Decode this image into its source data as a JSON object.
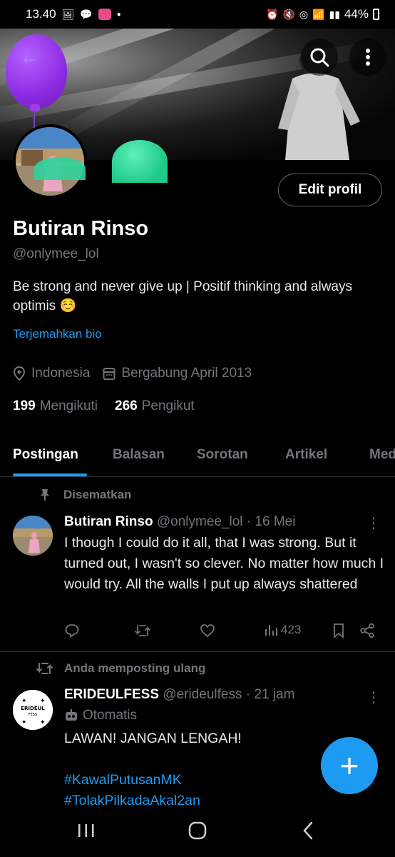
{
  "status_bar": {
    "time": "13.40",
    "battery": "44%",
    "app_icon_label": "LINE"
  },
  "profile": {
    "edit_label": "Edit profil",
    "name": "Butiran Rinso",
    "handle": "@onlymee_lol",
    "bio": "Be strong and never give up | Positif thinking and always optimis ☺️",
    "translate_label": "Terjemahkan bio",
    "location": "Indonesia",
    "joined": "Bergabung April 2013",
    "following_count": "199",
    "following_label": "Mengikuti",
    "followers_count": "266",
    "followers_label": "Pengikut"
  },
  "tabs": [
    "Postingan",
    "Balasan",
    "Sorotan",
    "Artikel",
    "Media"
  ],
  "pinned_post": {
    "pinned_label": "Disematkan",
    "author": "Butiran Rinso",
    "handle": "@onlymee_lol",
    "time": "· 16 Mei",
    "text": "I though I could do it all, that I was strong. But it turned out, I wasn't  so clever. No matter how much I would try. All the walls I put up always shattered",
    "views": "423"
  },
  "repost": {
    "repost_label": "Anda memposting ulang",
    "author": "ERIDEULFESS",
    "handle": "@erideulfess",
    "time": "· 21 jam",
    "auto_label": "Otomatis",
    "text": "LAWAN! JANGAN LENGAH!",
    "hashtag1": "#KawalPutusanMK",
    "hashtag2": "#TolakPilkadaAkal2an",
    "avatar_text": "ERIDEUL",
    "avatar_subtext": "FESS"
  },
  "fab_label": "+",
  "colors": {
    "accent": "#1d9bf0",
    "background": "#000000",
    "muted": "#71767b"
  }
}
